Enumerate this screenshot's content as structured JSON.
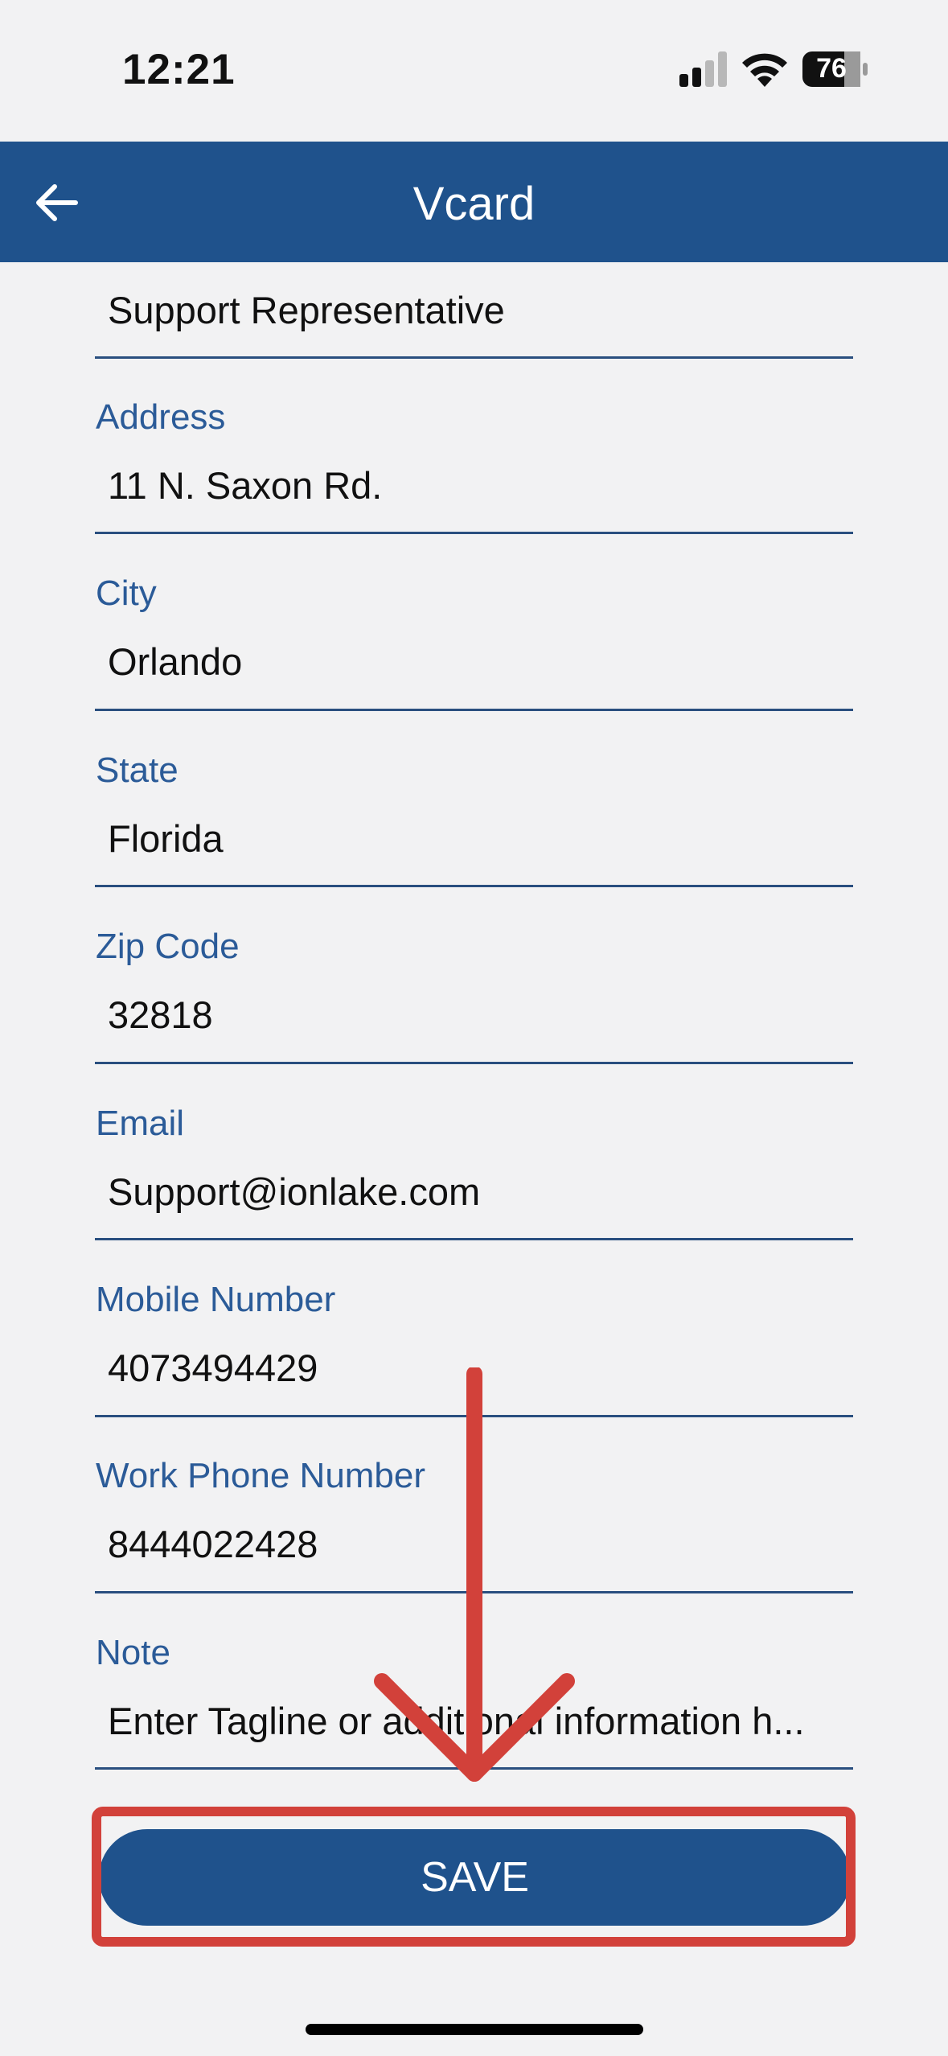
{
  "status_bar": {
    "time": "12:21",
    "battery": "76"
  },
  "nav": {
    "title": "Vcard",
    "back_icon": "arrow-left-icon"
  },
  "fields": {
    "title": {
      "value": "Support Representative"
    },
    "address": {
      "label": "Address",
      "value": "11 N. Saxon Rd."
    },
    "city": {
      "label": "City",
      "value": "Orlando"
    },
    "state": {
      "label": "State",
      "value": "Florida"
    },
    "zip": {
      "label": "Zip Code",
      "value": "32818"
    },
    "email": {
      "label": "Email",
      "value": "Support@ionlake.com"
    },
    "mobile": {
      "label": "Mobile Number",
      "value": "4073494429"
    },
    "work_phone": {
      "label": "Work Phone Number",
      "value": "8444022428"
    },
    "note": {
      "label": "Note",
      "value": "Enter Tagline or additional information h..."
    }
  },
  "save_button": {
    "label": "SAVE"
  },
  "annotation": {
    "highlight_color": "#d2413a",
    "arrow_color": "#d2413a"
  },
  "colors": {
    "brand": "#1f528c",
    "label": "#2b5b98",
    "background": "#f2f2f3"
  }
}
